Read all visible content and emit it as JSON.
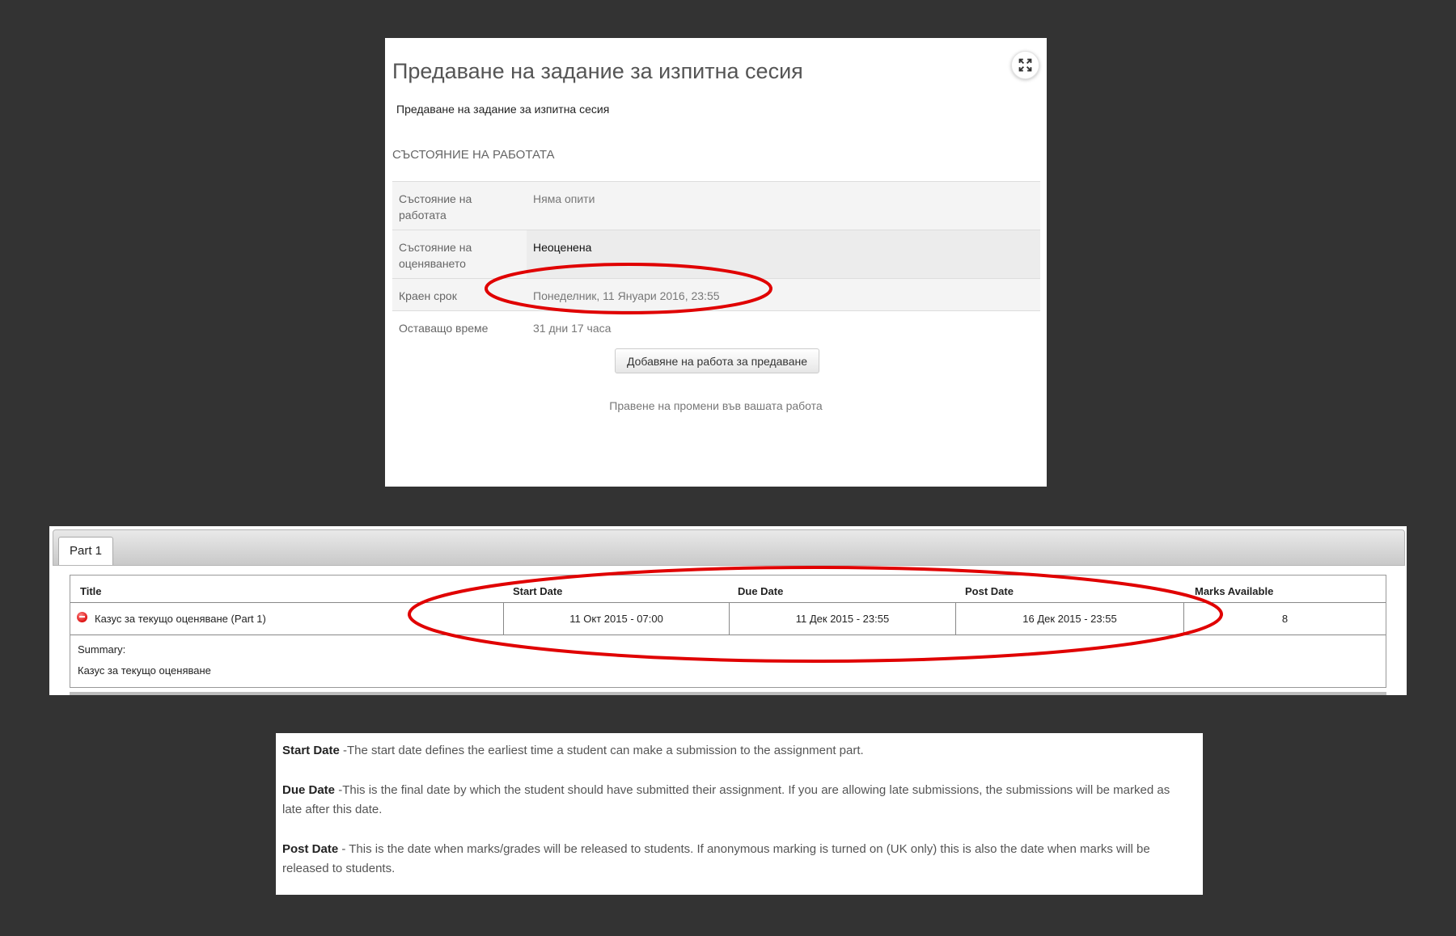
{
  "assignment_panel": {
    "title": "Предаване на задание за изпитна сесия",
    "subtitle": "Предаване на задание за изпитна сесия",
    "section_heading": "СЪСТОЯНИЕ НА РАБОТАТА",
    "rows": [
      {
        "label": "Състояние на работата",
        "value": "Няма опити"
      },
      {
        "label": "Състояние на оценяването",
        "value": "Неоценена"
      },
      {
        "label": "Краен срок",
        "value": "Понеделник, 11 Януари 2016, 23:55"
      },
      {
        "label": "Оставащо време",
        "value": "31 дни 17 часа"
      }
    ],
    "add_submission_button": "Добавяне на работа за предаване",
    "edit_note": "Правене на промени във вашата работа",
    "fullscreen_icon": "expand-icon"
  },
  "parts_panel": {
    "tab_label": "Part 1",
    "columns": [
      "Title",
      "Start Date",
      "Due Date",
      "Post Date",
      "Marks Available"
    ],
    "row": {
      "status_icon": "no-entry-icon",
      "title": "Казус за текущо оценяване (Part 1)",
      "start_date": "11 Окт 2015 - 07:00",
      "due_date": "11 Дек 2015 - 23:55",
      "post_date": "16 Дек 2015 - 23:55",
      "marks_available": "8"
    },
    "summary_label": "Summary:",
    "summary_text": "Казус за текущо оценяване"
  },
  "definitions_panel": {
    "items": [
      {
        "term": "Start Date",
        "text": " -The start date defines the earliest time a student can make a submission to the assignment part."
      },
      {
        "term": "Due Date",
        "text": " -This is the final date by which the student should have submitted their assignment. If you are allowing late submissions, the submissions will be marked as late after this date."
      },
      {
        "term": "Post Date",
        "text": " - This is the date when marks/grades will be released to students. If anonymous marking is turned on (UK only) this is also the date when marks will be released to students."
      }
    ]
  },
  "colors": {
    "background": "#333333",
    "annotation_oval": "#e00000"
  }
}
